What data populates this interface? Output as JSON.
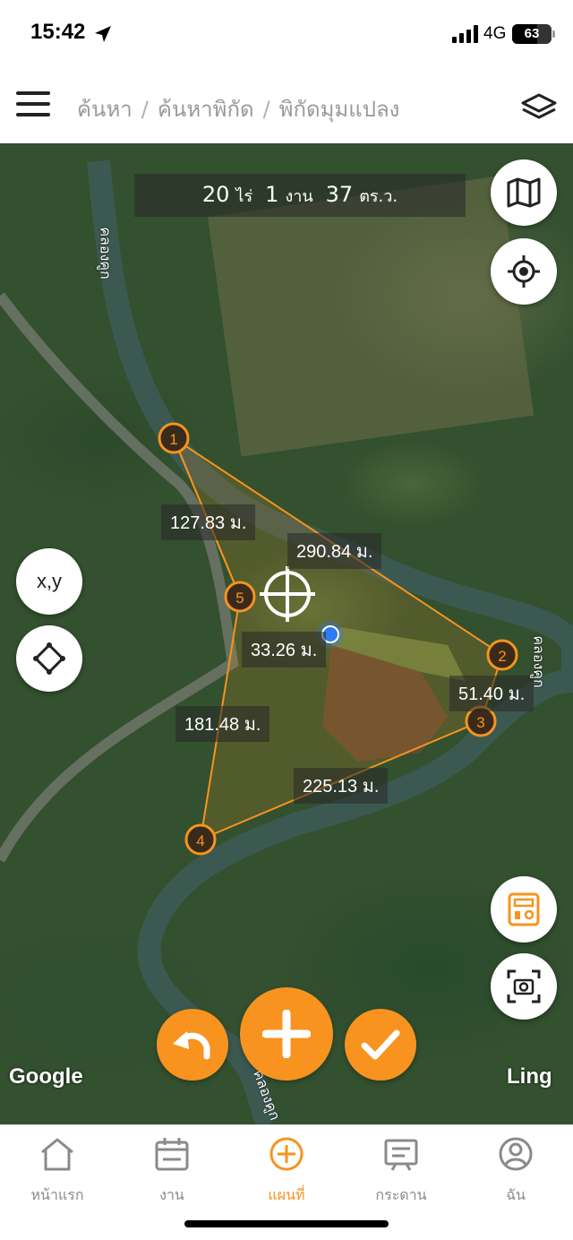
{
  "status_bar": {
    "time": "15:42",
    "network": "4G",
    "battery": "63",
    "battery_level": 0.63
  },
  "header": {
    "breadcrumb": [
      "ค้นหา",
      "ค้นหาพิกัด",
      "พิกัดมุมแปลง"
    ],
    "menu_icon": "hamburger-menu-icon",
    "layers_icon": "layers-icon"
  },
  "area": {
    "rai": "20",
    "rai_unit": "ไร่",
    "ngan": "1",
    "ngan_unit": "งาน",
    "wa": "37",
    "wa_unit": "ตร.ว."
  },
  "map_buttons": {
    "map_type_icon": "map-icon",
    "locate_icon": "gps-target-icon",
    "xy_label": "x,y",
    "polygon_icon": "diamond-shape-icon",
    "calculator_icon": "calculator-icon",
    "screenshot_icon": "screenshot-camera-icon"
  },
  "points": [
    "1",
    "2",
    "3",
    "4",
    "5"
  ],
  "distances": [
    "127.83 ม.",
    "290.84 ม.",
    "33.26 ม.",
    "51.40 ม.",
    "181.48 ม.",
    "225.13 ม."
  ],
  "canal_name": "คลองคูก",
  "map_attribution": {
    "google": "Google",
    "ling": "Ling"
  },
  "actions": {
    "undo_icon": "undo-icon",
    "add_icon": "plus-icon",
    "confirm_icon": "check-icon"
  },
  "bottom_nav": [
    {
      "label": "หน้าแรก",
      "icon": "home-icon"
    },
    {
      "label": "งาน",
      "icon": "calendar-icon"
    },
    {
      "label": "แผนที่",
      "icon": "add-circle-icon"
    },
    {
      "label": "กระดาน",
      "icon": "board-icon"
    },
    {
      "label": "ฉัน",
      "icon": "user-icon"
    }
  ],
  "colors": {
    "accent": "#f7931e",
    "polygon_line": "#f7931e",
    "point_fill": "#3a2a1a"
  }
}
